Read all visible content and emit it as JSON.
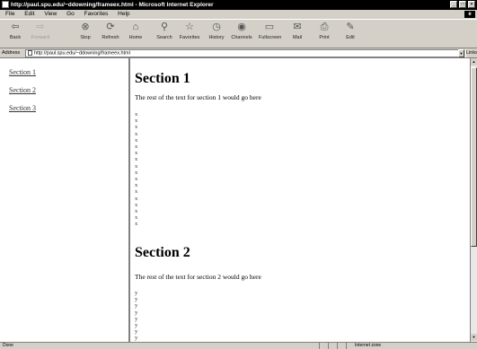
{
  "window": {
    "title": "http://paul.spu.edu/~ddowning/frameex.html - Microsoft Internet Explorer",
    "controls": [
      "_",
      "□",
      "×"
    ]
  },
  "menu": [
    "File",
    "Edit",
    "View",
    "Go",
    "Favorites",
    "Help"
  ],
  "toolbar": [
    {
      "label": "Back",
      "icon": "back-arrow-icon",
      "glyph": "⇦",
      "enabled": true
    },
    {
      "label": "Forward",
      "icon": "forward-arrow-icon",
      "glyph": "⇨",
      "enabled": false
    },
    {
      "label": "Stop",
      "icon": "stop-icon",
      "glyph": "⊗",
      "enabled": true
    },
    {
      "label": "Refresh",
      "icon": "refresh-icon",
      "glyph": "⟳",
      "enabled": true
    },
    {
      "label": "Home",
      "icon": "home-icon",
      "glyph": "⌂",
      "enabled": true
    },
    {
      "label": "Search",
      "icon": "search-icon",
      "glyph": "⚲",
      "enabled": true
    },
    {
      "label": "Favorites",
      "icon": "favorites-icon",
      "glyph": "☆",
      "enabled": true
    },
    {
      "label": "History",
      "icon": "history-icon",
      "glyph": "◷",
      "enabled": true
    },
    {
      "label": "Channels",
      "icon": "channels-icon",
      "glyph": "◉",
      "enabled": true
    },
    {
      "label": "Fullscreen",
      "icon": "fullscreen-icon",
      "glyph": "▭",
      "enabled": true
    },
    {
      "label": "Mail",
      "icon": "mail-icon",
      "glyph": "✉",
      "enabled": true
    },
    {
      "label": "Print",
      "icon": "print-icon",
      "glyph": "⎙",
      "enabled": true
    },
    {
      "label": "Edit",
      "icon": "edit-icon",
      "glyph": "✎",
      "enabled": true
    }
  ],
  "address": {
    "label": "Address",
    "url": "http://paul.spu.edu/~ddowning/frameex.html",
    "links_label": "Links"
  },
  "nav": {
    "links": [
      "Section 1",
      "Section 2",
      "Section 3"
    ]
  },
  "content": {
    "sections": [
      {
        "title": "Section 1",
        "text": "The rest of the text for section 1 would go here",
        "marker": "x",
        "marker_count": 18
      },
      {
        "title": "Section 2",
        "text": "The rest of the text for section 2 would go here",
        "marker": "y",
        "marker_count": 8
      }
    ]
  },
  "status": {
    "text": "Done",
    "zone": "Internet zone"
  },
  "brand_glyph": "e"
}
